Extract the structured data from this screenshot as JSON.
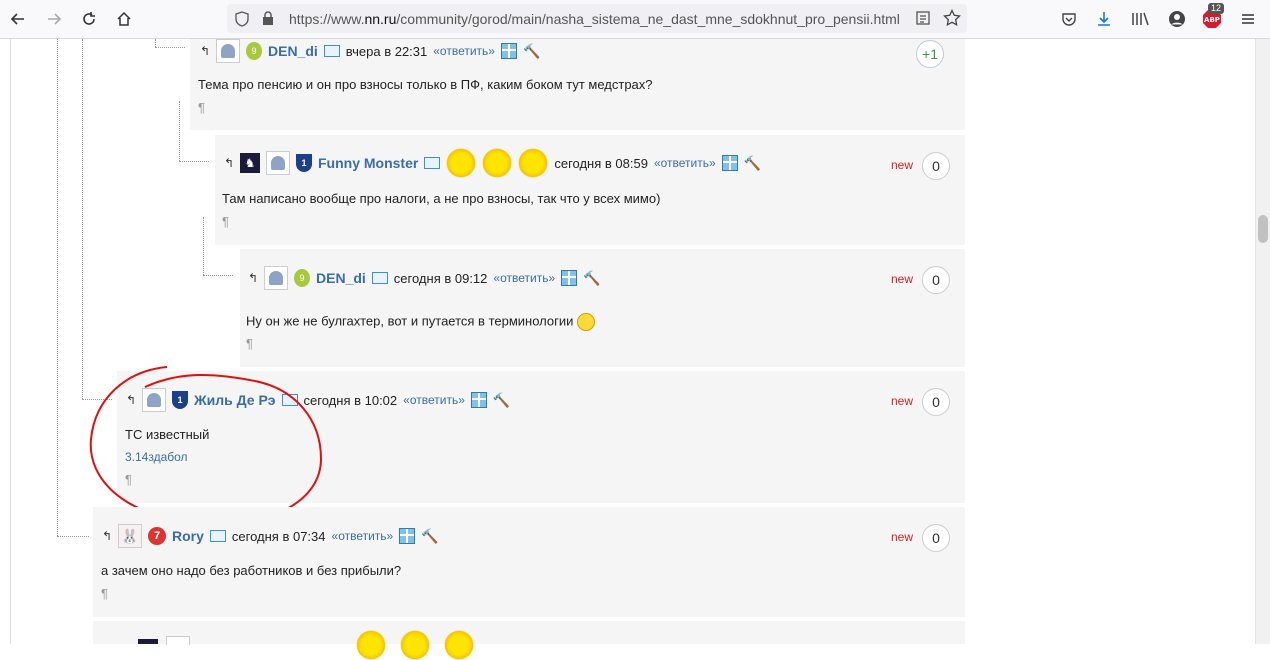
{
  "browser": {
    "url_prefix": "https://www.",
    "url_host": "nn.ru",
    "url_path": "/community/gorod/main/nasha_sistema_ne_dast_mne_sdokhnut_pro_pensii.html",
    "addon_badge": "12"
  },
  "comments": [
    {
      "user": "DEN_di",
      "date": "вчера в 22:31",
      "reply": "«ответить»",
      "new": "",
      "count": "+1",
      "text": "Тема про пенсию и он про взносы только в ПФ, каким боком тут медстрах?",
      "pilcrow": "¶"
    },
    {
      "user": "Funny Monster",
      "date": "сегодня в 08:59",
      "reply": "«ответить»",
      "new": "new",
      "count": "0",
      "text": "Там написано вообще про налоги, а не про взносы, так что у всех мимо)",
      "pilcrow": "¶"
    },
    {
      "user": "DEN_di",
      "date": "сегодня в 09:12",
      "reply": "«ответить»",
      "new": "new",
      "count": "0",
      "text": "Ну он же не булгахтер, вот и путается в терминологии",
      "pilcrow": "¶"
    },
    {
      "user": "Жиль Де Рэ",
      "date": "сегодня в 10:02",
      "reply": "«ответить»",
      "new": "new",
      "count": "0",
      "text": "ТС известный",
      "signature": "3.14здабол",
      "pilcrow": "¶"
    },
    {
      "user": "Rory",
      "date": "сегодня в 07:34",
      "reply": "«ответить»",
      "new": "new",
      "count": "0",
      "text": "а зачем оно надо без работников и без прибыли?",
      "pilcrow": "¶"
    }
  ],
  "colors": {
    "username": "#3a6ca8",
    "new_label": "#d62020",
    "annotation_circle": "#e01010"
  }
}
